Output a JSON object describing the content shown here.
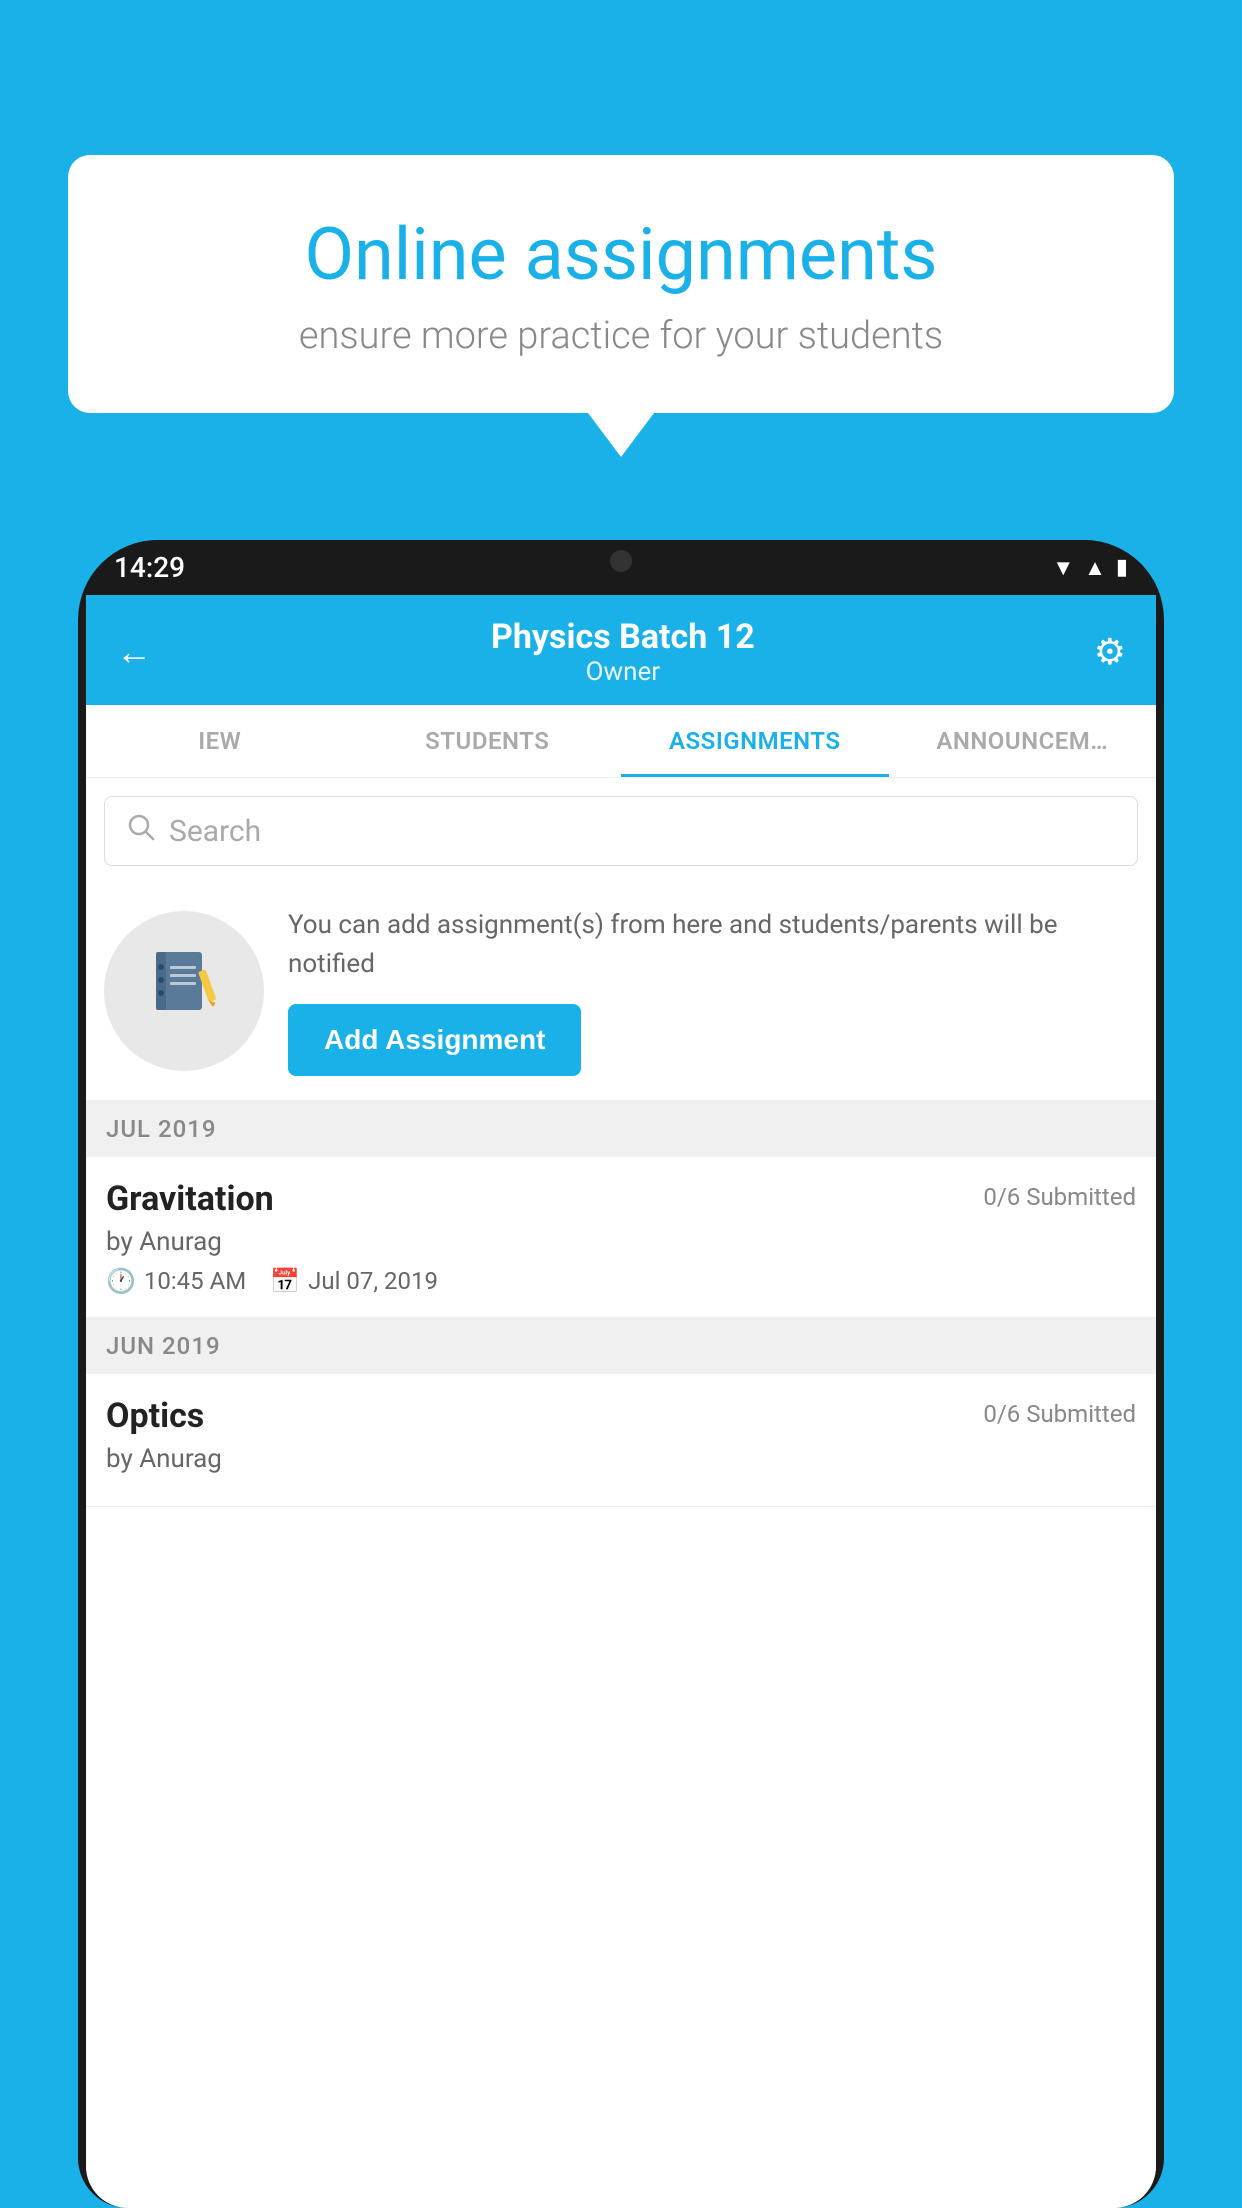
{
  "background_color": "#1ab0e8",
  "speech_bubble": {
    "title": "Online assignments",
    "subtitle": "ensure more practice for your students"
  },
  "phone": {
    "status_bar": {
      "time": "14:29"
    },
    "header": {
      "title": "Physics Batch 12",
      "subtitle": "Owner",
      "back_label": "←",
      "settings_label": "⚙"
    },
    "tabs": [
      {
        "label": "IEW",
        "active": false
      },
      {
        "label": "STUDENTS",
        "active": false
      },
      {
        "label": "ASSIGNMENTS",
        "active": true
      },
      {
        "label": "ANNOUNCEM…",
        "active": false
      }
    ],
    "search": {
      "placeholder": "Search"
    },
    "promo": {
      "text": "You can add assignment(s) from here and students/parents will be notified",
      "button_label": "Add Assignment"
    },
    "sections": [
      {
        "month": "JUL 2019",
        "assignments": [
          {
            "title": "Gravitation",
            "submitted": "0/6 Submitted",
            "by": "by Anurag",
            "time": "10:45 AM",
            "date": "Jul 07, 2019"
          }
        ]
      },
      {
        "month": "JUN 2019",
        "assignments": [
          {
            "title": "Optics",
            "submitted": "0/6 Submitted",
            "by": "by Anurag",
            "time": "",
            "date": ""
          }
        ]
      }
    ]
  }
}
